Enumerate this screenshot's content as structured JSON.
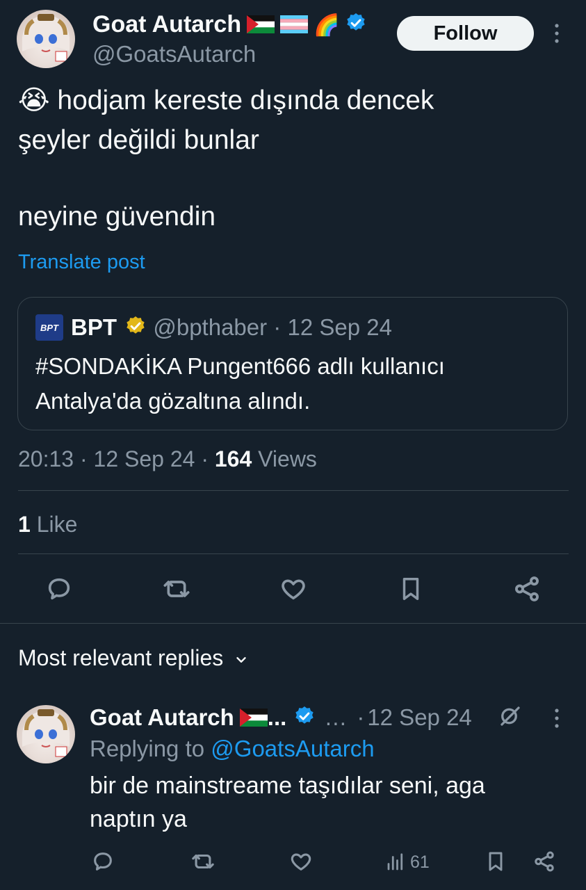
{
  "tweet": {
    "author_name": "Goat Autarch",
    "author_emoji": "🌈",
    "author_handle": "@GoatsAutarch",
    "follow_label": "Follow",
    "more_icon": "more-vertical-icon",
    "emoji": "😭",
    "text_line1": "hodjam kereste dışında dencek",
    "text_line2": "şeyler değildi bunlar",
    "text_line3": "neyine güvendin",
    "translate_label": "Translate post",
    "time": "20:13",
    "date": "12 Sep 24",
    "views_count": "164",
    "views_label": "Views",
    "likes_count": "1",
    "likes_label": "Like"
  },
  "quote": {
    "logo_text": "BPT",
    "name": "BPT",
    "handle": "@bpthaber",
    "date": "12 Sep 24",
    "text_line1": "#SONDAKİKA Pungent666 adlı kullanıcı",
    "text_line2": "Antalya'da gözaltına alındı."
  },
  "replies_section": {
    "title": "Most relevant replies"
  },
  "reply": {
    "author_name": "Goat Autarch",
    "ellipsis": "...",
    "ellipsis2": "…",
    "date": "12 Sep 24",
    "replying_label": "Replying to",
    "replying_handle": "@GoatsAutarch",
    "text_line1": "bir de mainstreame taşıdılar seni, aga",
    "text_line2": "naptın ya",
    "views": "61"
  },
  "colors": {
    "background": "#15202b",
    "text": "#f7f9f9",
    "muted": "#8b98a5",
    "accent": "#1d9bf0",
    "gold_badge": "#e2b719"
  }
}
